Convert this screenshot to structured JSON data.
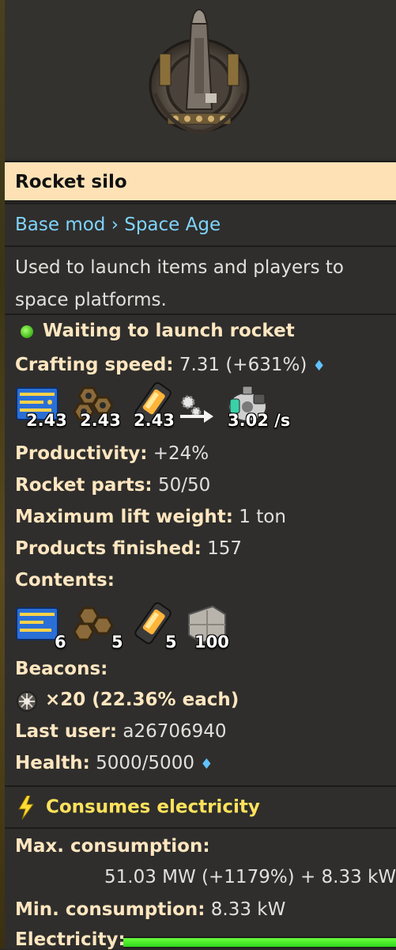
{
  "entity": {
    "name": "Rocket silo",
    "icon": "rocket-silo-icon"
  },
  "breadcrumb": {
    "base": "Base mod",
    "separator": "›",
    "mod": "Space Age"
  },
  "description": "Used to launch items and players to space platforms.",
  "status": {
    "text": "Waiting to launch rocket",
    "color": "#4fd02a"
  },
  "crafting_speed": {
    "label": "Crafting speed:",
    "value": "7.31 (+631%)",
    "diamond": "♦"
  },
  "recipe": {
    "ingredients": [
      {
        "icon": "processing-unit-icon",
        "amount": "2.43"
      },
      {
        "icon": "low-density-structure-icon",
        "amount": "2.43"
      },
      {
        "icon": "rocket-fuel-icon",
        "amount": "2.43"
      }
    ],
    "arrow_icon": "craft-arrow-icon",
    "product": {
      "icon": "rocket-part-icon",
      "amount": "3.02 /s"
    }
  },
  "stats": {
    "productivity_label": "Productivity:",
    "productivity_value": "+24%",
    "rocket_parts_label": "Rocket parts:",
    "rocket_parts_value": "50/50",
    "lift_label": "Maximum lift weight:",
    "lift_value": "1 ton",
    "finished_label": "Products finished:",
    "finished_value": "157",
    "contents_label": "Contents:"
  },
  "contents": [
    {
      "icon": "processing-unit-icon",
      "count": "6"
    },
    {
      "icon": "low-density-structure-icon",
      "count": "5"
    },
    {
      "icon": "rocket-fuel-icon",
      "count": "5"
    },
    {
      "icon": "concrete-icon",
      "count": "100"
    }
  ],
  "beacons": {
    "label": "Beacons:",
    "icon": "beacon-icon",
    "text": "×20 (22.36% each)"
  },
  "last_user": {
    "label": "Last user:",
    "value": "a26706940"
  },
  "health": {
    "label": "Health:",
    "value": "5000/5000",
    "diamond": "♦"
  },
  "electricity": {
    "heading": "Consumes electricity",
    "icon": "lightning-icon",
    "max_label": "Max. consumption:",
    "max_value": "51.03 MW (+1179%) + 8.33 kW",
    "min_label": "Min. consumption:",
    "min_value": "8.33 kW",
    "bar_label": "Electricity:",
    "bar_fill_fraction": 1.0,
    "bar_color": "#3fe524"
  }
}
